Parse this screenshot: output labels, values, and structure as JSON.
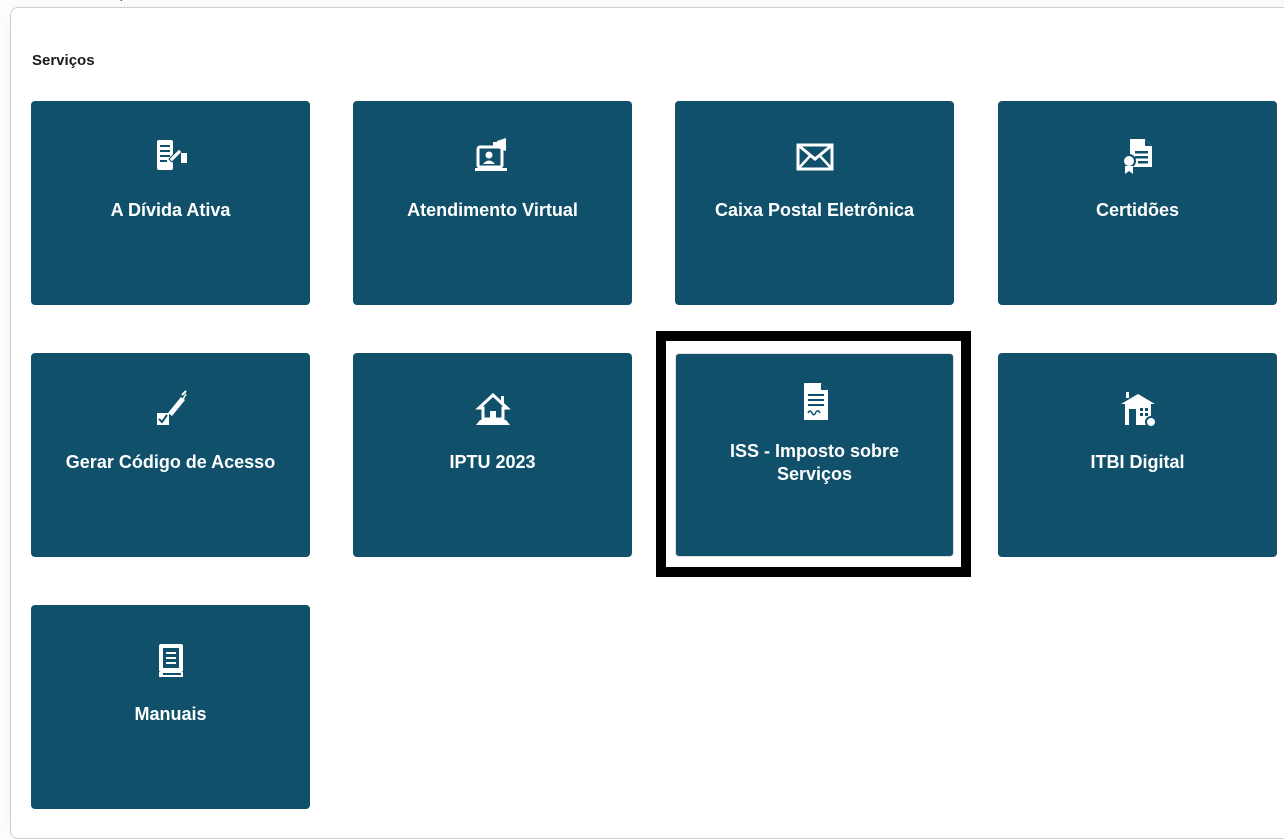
{
  "section": {
    "title": "Serviços"
  },
  "tiles": [
    {
      "label": "A Dívida Ativa",
      "icon": "debt-document-icon"
    },
    {
      "label": "Atendimento Virtual",
      "icon": "virtual-support-icon"
    },
    {
      "label": "Caixa Postal Eletrônica",
      "icon": "envelope-icon"
    },
    {
      "label": "Certidões",
      "icon": "certificate-icon"
    },
    {
      "label": "Gerar Código de Acesso",
      "icon": "checkbox-pen-icon"
    },
    {
      "label": "IPTU 2023",
      "icon": "house-icon"
    },
    {
      "label": "ISS - Imposto sobre Serviços",
      "icon": "signed-document-icon"
    },
    {
      "label": "ITBI Digital",
      "icon": "building-icon"
    },
    {
      "label": "Manuais",
      "icon": "manual-book-icon"
    }
  ],
  "colors": {
    "tile_background": "#10506b",
    "tile_text": "#ffffff",
    "highlight_border": "#000000"
  }
}
